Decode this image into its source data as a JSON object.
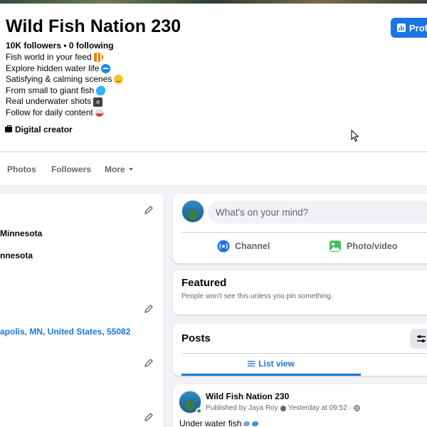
{
  "page": {
    "title": "Wild Fish Nation 230",
    "stats": "10K followers • 0 following",
    "professional_button": "Profe",
    "bio": [
      {
        "text": "Fish world in your feed",
        "icon": "tropical-fish-emoji"
      },
      {
        "text": "Explore hidden water life",
        "icon": "wave-emoji"
      },
      {
        "text": "Satisfying & calming scenes",
        "icon": "smiling-face-emoji"
      },
      {
        "text": "From small to giant fish",
        "icon": "fish-emoji"
      },
      {
        "text": "Real underwater shots",
        "icon": "camera-emoji"
      },
      {
        "text": "Follow for daily content",
        "icon": "rocket-emoji"
      }
    ],
    "category": "Digital creator"
  },
  "tabs": [
    {
      "label": "Photos"
    },
    {
      "label": "Followers"
    },
    {
      "label": "More"
    }
  ],
  "intro": {
    "lines": [
      "Minnesota",
      "nnesota"
    ],
    "address": "apolis, MN, United States, 55082"
  },
  "composer": {
    "placeholder": "What's on your mind?",
    "actions": [
      {
        "label": "Channel",
        "icon": "channel-icon"
      },
      {
        "label": "Photo/video",
        "icon": "photo-video-icon"
      }
    ]
  },
  "featured": {
    "title": "Featured",
    "subtitle": "People won't see this unless you pin something."
  },
  "posts": {
    "title": "Posts",
    "list_view": "List view"
  },
  "post": {
    "author": "Wild Fish Nation 230",
    "published_by": "Published by Jaya Roy",
    "timestamp": "Yesterday at 09:52 ·",
    "text": "Under water fish"
  },
  "colors": {
    "accent": "#1b74e4",
    "secondary_text": "#65676b",
    "background": "#f0f2f5",
    "online": "#31a24c"
  }
}
